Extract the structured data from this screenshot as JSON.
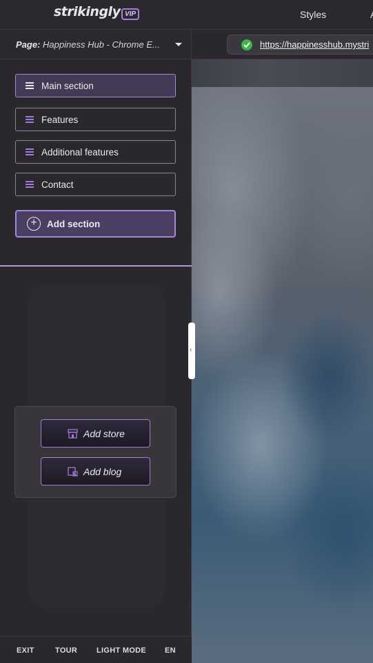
{
  "header": {
    "logo": "strikingly",
    "badge": "VIP",
    "nav": [
      "Styles",
      "A"
    ]
  },
  "page_selector": {
    "prefix": "Page:",
    "value": "Happiness Hub - Chrome E..."
  },
  "url_bar": {
    "url": "https://happinesshub.mystri"
  },
  "sections": [
    {
      "label": "Main section",
      "active": true
    },
    {
      "label": "Features",
      "active": false
    },
    {
      "label": "Additional features",
      "active": false
    },
    {
      "label": "Contact",
      "active": false
    }
  ],
  "add_section_label": "Add section",
  "add_buttons": {
    "store": "Add store",
    "blog": "Add blog"
  },
  "footer": {
    "exit": "EXIT",
    "tour": "TOUR",
    "light_mode": "LIGHT MODE",
    "language": "EN"
  },
  "colors": {
    "accent": "#a489d8",
    "background": "#2a282d",
    "success": "#3cb54a"
  }
}
